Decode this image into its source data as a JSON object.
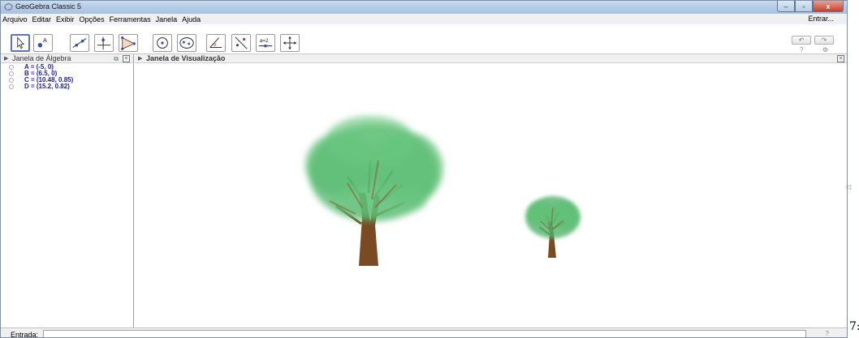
{
  "window": {
    "title": "GeoGebra Classic 5",
    "controls": {
      "minimize": "–",
      "maximize": "▫",
      "close": "x"
    }
  },
  "menu": {
    "items": [
      "Arquivo",
      "Editar",
      "Exibir",
      "Opções",
      "Ferramentas",
      "Janela",
      "Ajuda"
    ],
    "login": "Entrar..."
  },
  "toolbar": {
    "tools": [
      {
        "name": "move",
        "icon": "move-arrow-icon",
        "selected": true
      },
      {
        "name": "point",
        "icon": "point-icon",
        "label": "A"
      },
      {
        "name": "line",
        "icon": "line-icon"
      },
      {
        "name": "perpendicular",
        "icon": "perpendicular-line-icon"
      },
      {
        "name": "polygon",
        "icon": "polygon-icon"
      },
      {
        "name": "circle-center-point",
        "icon": "circle-center-icon"
      },
      {
        "name": "ellipse",
        "icon": "ellipse-icon"
      },
      {
        "name": "angle",
        "icon": "angle-icon",
        "label": "α"
      },
      {
        "name": "reflect",
        "icon": "reflect-line-icon"
      },
      {
        "name": "slider",
        "icon": "slider-icon",
        "label": "a=2"
      },
      {
        "name": "move-graphics",
        "icon": "move-graphics-icon"
      }
    ],
    "undo": "↶",
    "redo": "↷",
    "help": "?",
    "settings": "⚙"
  },
  "algebra": {
    "title": "Janela de Álgebra",
    "items": [
      "A = (-5, 0)",
      "B = (6.5, 0)",
      "C = (10.48, 0.85)",
      "D = (15.2, 0.82)"
    ]
  },
  "graphics": {
    "title": "Janela de Visualização",
    "image_description_icons": [
      "large-tree",
      "small-tree"
    ]
  },
  "input": {
    "label": "Entrada:",
    "value": "",
    "help": "?"
  },
  "side": {
    "collapse": "◁",
    "fragment": "7:"
  },
  "colors": {
    "algebra_text": "#1a1ab0",
    "selected_tool_border": "#5a72c8",
    "foliage": "#3fae5e",
    "trunk": "#7a4a22"
  }
}
